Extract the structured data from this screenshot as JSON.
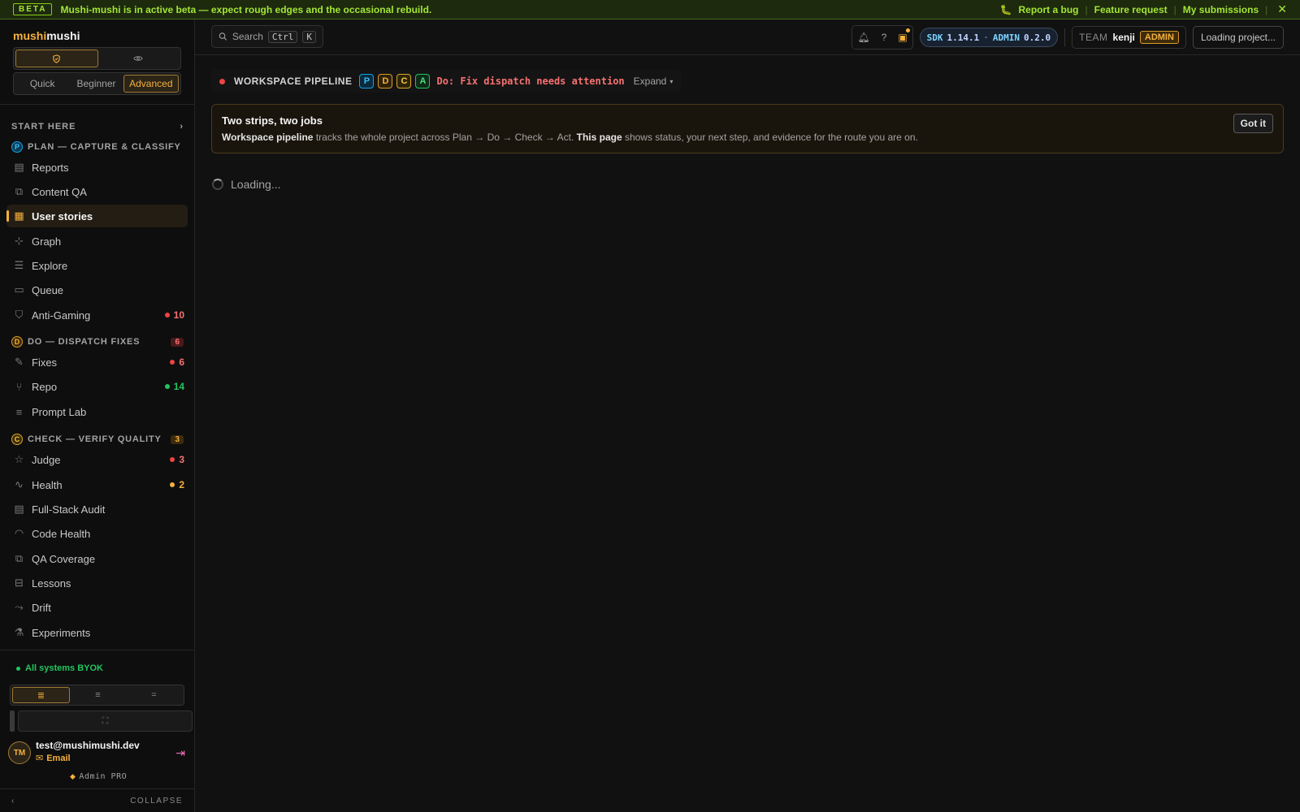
{
  "beta": {
    "tag": "BETA",
    "message": "Mushi-mushi is in active beta — expect rough edges and the occasional rebuild.",
    "report_bug": "Report a bug",
    "feature_request": "Feature request",
    "my_submissions": "My submissions",
    "close": "✕"
  },
  "brand": {
    "part1": "mushi",
    "part2": "mushi"
  },
  "modes": [
    "Quick",
    "Beginner",
    "Advanced"
  ],
  "active_mode": "Advanced",
  "nav": {
    "start_here": "START HERE",
    "plan": {
      "pill": "P",
      "title": "PLAN — CAPTURE & CLASSIFY",
      "items": [
        {
          "label": "Reports"
        },
        {
          "label": "Content QA"
        },
        {
          "label": "User stories",
          "active": true
        },
        {
          "label": "Graph"
        },
        {
          "label": "Explore"
        },
        {
          "label": "Queue"
        },
        {
          "label": "Anti-Gaming",
          "count": "10",
          "color": "red"
        }
      ]
    },
    "do": {
      "pill": "D",
      "title": "DO — DISPATCH FIXES",
      "count": "6",
      "items": [
        {
          "label": "Fixes",
          "count": "6",
          "color": "red"
        },
        {
          "label": "Repo",
          "count": "14",
          "color": "green"
        },
        {
          "label": "Prompt Lab"
        }
      ]
    },
    "check": {
      "pill": "C",
      "title": "CHECK — VERIFY QUALITY",
      "count": "3",
      "items": [
        {
          "label": "Judge",
          "count": "3",
          "color": "red"
        },
        {
          "label": "Health",
          "count": "2",
          "color": "amber"
        },
        {
          "label": "Full-Stack Audit"
        },
        {
          "label": "Code Health"
        },
        {
          "label": "QA Coverage"
        },
        {
          "label": "Lessons"
        },
        {
          "label": "Drift"
        },
        {
          "label": "Experiments"
        }
      ]
    }
  },
  "footer": {
    "status": "All systems BYOK",
    "user_initials": "TM",
    "user_email": "test@mushimushi.dev",
    "auth_method": "Email",
    "plan": "Admin PRO",
    "collapse": "COLLAPSE"
  },
  "topbar": {
    "search_label": "Search",
    "kbd1": "Ctrl",
    "kbd2": "K",
    "sdk_label": "SDK",
    "sdk_version": "1.14.1",
    "admin_label": "ADMIN",
    "admin_version": "0.2.0",
    "team_label": "TEAM",
    "team_user": "kenji",
    "team_role": "ADMIN",
    "project": "Loading project..."
  },
  "pipeline": {
    "title": "WORKSPACE PIPELINE",
    "steps": [
      "P",
      "D",
      "C",
      "A"
    ],
    "alert": "Do: Fix dispatch needs attention",
    "expand": "Expand"
  },
  "notice": {
    "heading": "Two strips, two jobs",
    "b1": "Workspace pipeline",
    "t1": " tracks the whole project across Plan → Do → Check → Act. ",
    "b2": "This page",
    "t2": " shows status, your next step, and evidence for the route you are on.",
    "button": "Got it"
  },
  "loading": "Loading..."
}
